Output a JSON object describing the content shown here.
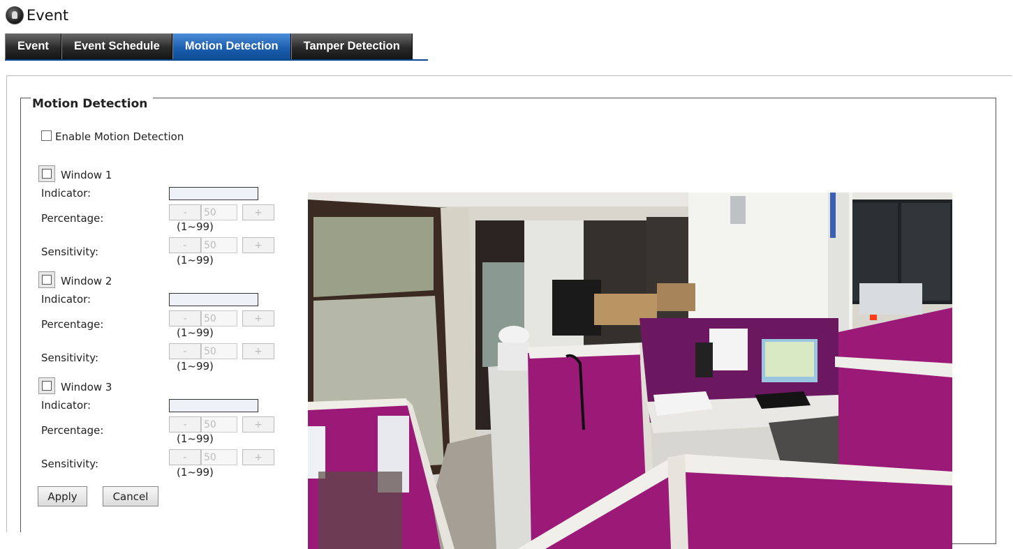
{
  "header": {
    "title": "Event"
  },
  "tabs": [
    {
      "label": "Event",
      "active": false
    },
    {
      "label": "Event Schedule",
      "active": false
    },
    {
      "label": "Motion Detection",
      "active": true
    },
    {
      "label": "Tamper Detection",
      "active": false
    }
  ],
  "panel": {
    "legend": "Motion Detection",
    "enable_label": "Enable Motion Detection",
    "enable_checked": false,
    "windows": [
      {
        "label": "Window 1",
        "checked": false,
        "indicator_label": "Indicator:",
        "percentage_label": "Percentage:",
        "percentage_value": "50",
        "percentage_range": "(1~99)",
        "sensitivity_label": "Sensitivity:",
        "sensitivity_value": "50",
        "sensitivity_range": "(1~99)"
      },
      {
        "label": "Window 2",
        "checked": false,
        "indicator_label": "Indicator:",
        "percentage_label": "Percentage:",
        "percentage_value": "50",
        "percentage_range": "(1~99)",
        "sensitivity_label": "Sensitivity:",
        "sensitivity_value": "50",
        "sensitivity_range": "(1~99)"
      },
      {
        "label": "Window 3",
        "checked": false,
        "indicator_label": "Indicator:",
        "percentage_label": "Percentage:",
        "percentage_value": "50",
        "percentage_range": "(1~99)",
        "sensitivity_label": "Sensitivity:",
        "sensitivity_value": "50",
        "sensitivity_range": "(1~99)"
      }
    ],
    "stepper": {
      "minus": "-",
      "plus": "+"
    },
    "apply_label": "Apply",
    "cancel_label": "Cancel"
  },
  "colors": {
    "tab_active": "#1d5faf",
    "tab_inactive": "#2a2a2a",
    "cubicle": "#9b1a78"
  },
  "icons": {
    "title_icon": "camera-lens-icon"
  }
}
